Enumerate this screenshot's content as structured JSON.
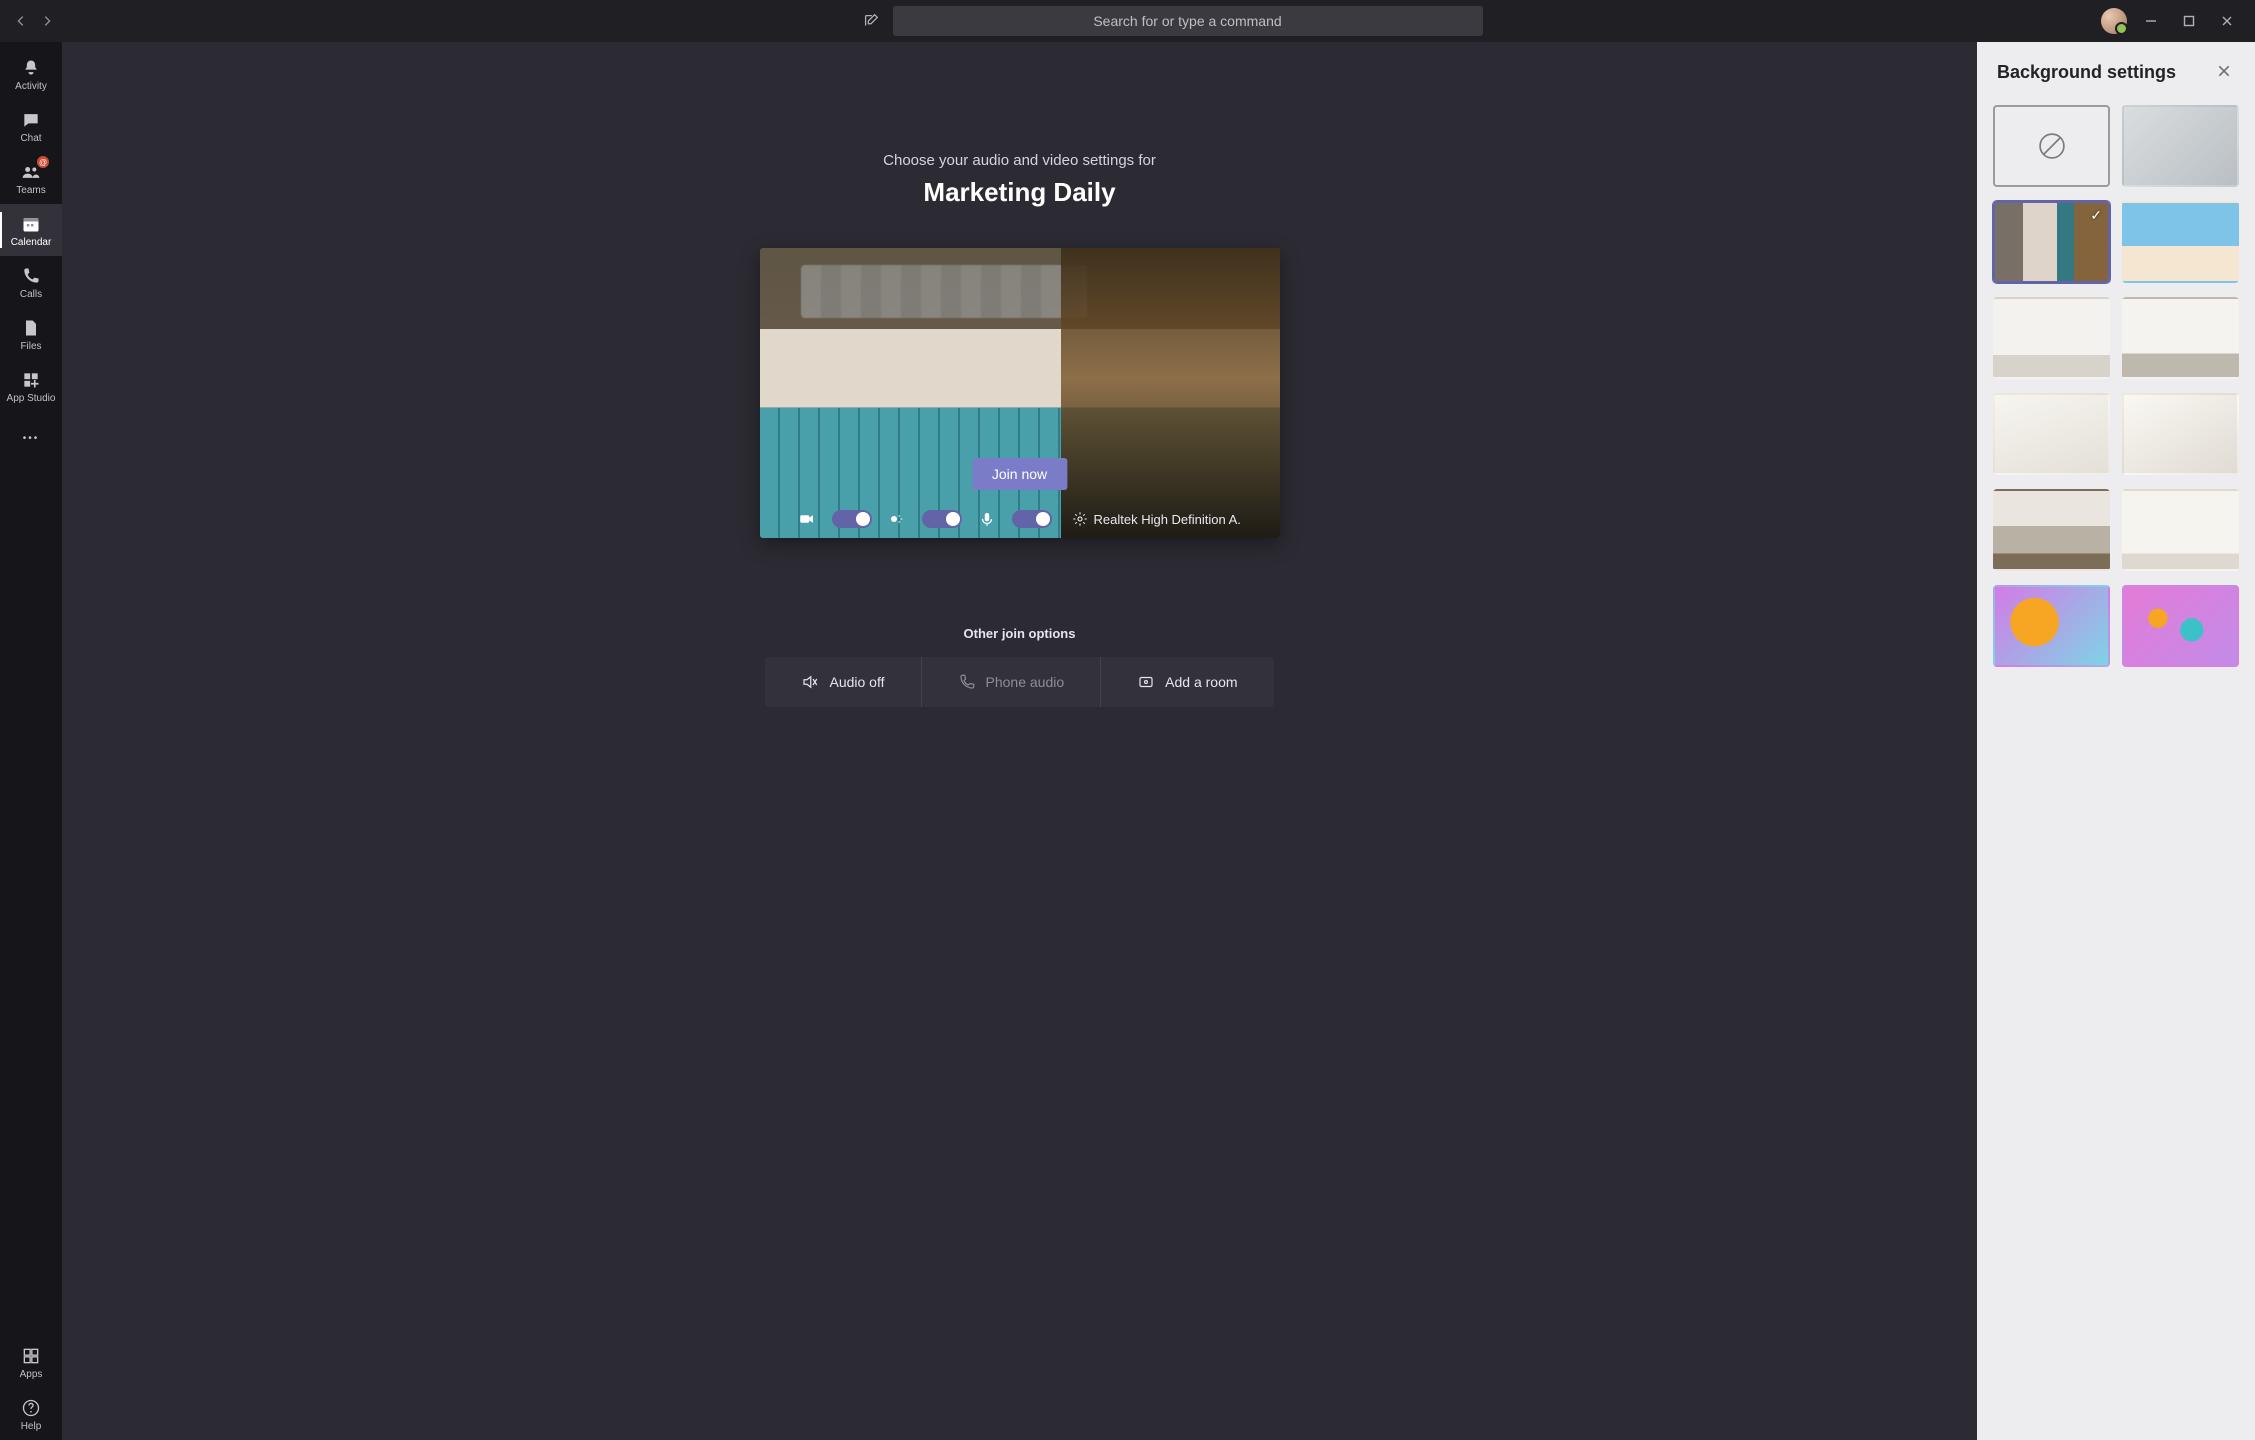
{
  "search": {
    "placeholder": "Search for or type a command"
  },
  "rail": {
    "items": [
      {
        "label": "Activity"
      },
      {
        "label": "Chat"
      },
      {
        "label": "Teams",
        "badge": "@"
      },
      {
        "label": "Calendar"
      },
      {
        "label": "Calls"
      },
      {
        "label": "Files"
      },
      {
        "label": "App Studio"
      }
    ],
    "bottom": [
      {
        "label": "Apps"
      },
      {
        "label": "Help"
      }
    ],
    "activeIndex": 3
  },
  "stage": {
    "prompt": "Choose your audio and video settings for",
    "meeting_title": "Marketing Daily",
    "join_label": "Join now",
    "device_label": "Realtek High Definition A...",
    "other_options_label": "Other join options",
    "options": [
      {
        "label": "Audio off",
        "icon": "speaker-off",
        "disabled": false
      },
      {
        "label": "Phone audio",
        "icon": "phone",
        "disabled": true
      },
      {
        "label": "Add a room",
        "icon": "room",
        "disabled": false
      }
    ],
    "toggles": {
      "video": true,
      "blur": true,
      "mic": true
    }
  },
  "bg_panel": {
    "title": "Background settings",
    "selectedIndex": 2,
    "thumbs": [
      {
        "kind": "none",
        "name": "no-background"
      },
      {
        "kind": "blur",
        "name": "blur-background"
      },
      {
        "kind": "office1",
        "name": "lockers-office"
      },
      {
        "kind": "beach",
        "name": "beach"
      },
      {
        "kind": "room1",
        "name": "white-room-1"
      },
      {
        "kind": "room2",
        "name": "white-room-2"
      },
      {
        "kind": "room3",
        "name": "white-room-3"
      },
      {
        "kind": "room4",
        "name": "white-room-4"
      },
      {
        "kind": "loft",
        "name": "loft-windows"
      },
      {
        "kind": "room5",
        "name": "white-room-5"
      },
      {
        "kind": "balloons1",
        "name": "balloons-1"
      },
      {
        "kind": "balloons2",
        "name": "balloons-2"
      }
    ]
  },
  "colors": {
    "accent": "#6264a7"
  }
}
